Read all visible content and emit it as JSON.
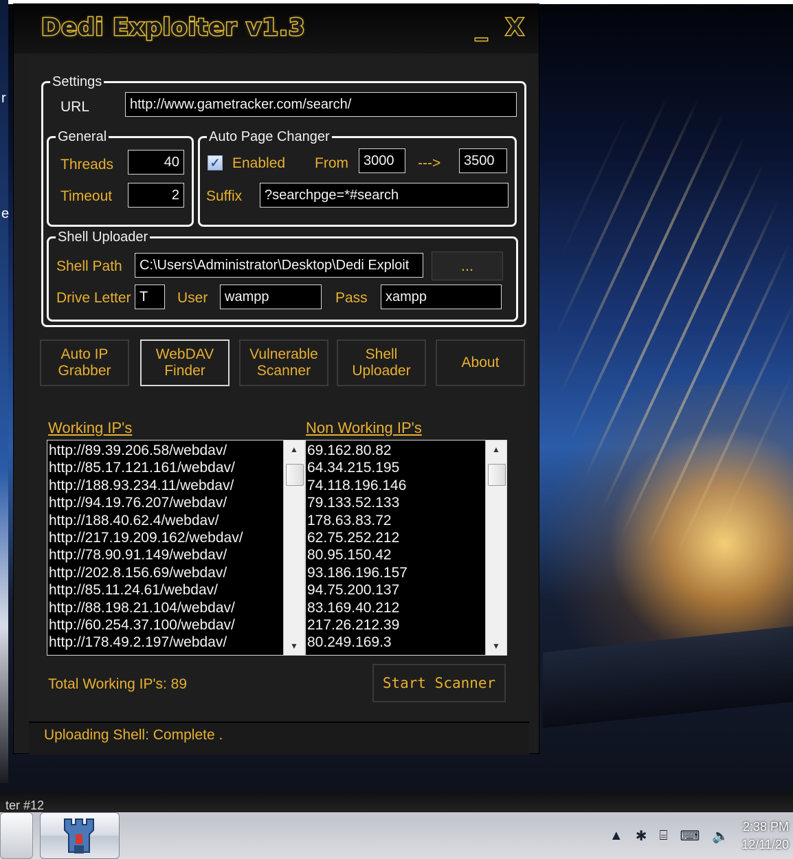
{
  "window": {
    "title": "Dedi Exploiter v1.3",
    "minimize": "_",
    "close": "X"
  },
  "settings": {
    "legend": "Settings",
    "url_label": "URL",
    "url_value": "http://www.gametracker.com/search/"
  },
  "general": {
    "legend": "General",
    "threads_label": "Threads",
    "threads_value": "40",
    "timeout_label": "Timeout",
    "timeout_value": "2"
  },
  "auto_page": {
    "legend": "Auto Page Changer",
    "enabled_label": "Enabled",
    "enabled_checked": true,
    "from_label": "From",
    "from_value": "3000",
    "arrow": "--->",
    "to_value": "3500",
    "suffix_label": "Suffix",
    "suffix_value": "?searchpge=*#search"
  },
  "shell": {
    "legend": "Shell Uploader",
    "path_label": "Shell Path",
    "path_value": "C:\\Users\\Administrator\\Desktop\\Dedi Exploit",
    "browse_label": "...",
    "drive_label": "Drive Letter",
    "drive_value": "T",
    "user_label": "User",
    "user_value": "wampp",
    "pass_label": "Pass",
    "pass_value": "xampp"
  },
  "tabs": [
    {
      "line1": "Auto IP",
      "line2": "Grabber"
    },
    {
      "line1": "WebDAV",
      "line2": "Finder"
    },
    {
      "line1": "Vulnerable",
      "line2": "Scanner"
    },
    {
      "line1": "Shell",
      "line2": "Uploader"
    },
    {
      "line1": "About",
      "line2": ""
    }
  ],
  "working": {
    "title": "Working IP's",
    "items": [
      "http://89.39.206.58/webdav/",
      "http://85.17.121.161/webdav/",
      "http://188.93.234.11/webdav/",
      "http://94.19.76.207/webdav/",
      "http://188.40.62.4/webdav/",
      "http://217.19.209.162/webdav/",
      "http://78.90.91.149/webdav/",
      "http://202.8.156.69/webdav/",
      "http://85.11.24.61/webdav/",
      "http://88.198.21.104/webdav/",
      "http://60.254.37.100/webdav/",
      "http://178.49.2.197/webdav/"
    ]
  },
  "nonworking": {
    "title": "Non Working IP's",
    "items": [
      "69.162.80.82",
      "64.34.215.195",
      "74.118.196.146",
      "79.133.52.133",
      "178.63.83.72",
      "62.75.252.212",
      "80.95.150.42",
      "93.186.196.157",
      "94.75.200.137",
      "83.169.40.212",
      "217.26.212.39",
      "80.249.169.3"
    ]
  },
  "total_label": "Total Working IP's: 89",
  "start_label": "Start  Scanner",
  "status": "Uploading Shell: Complete .",
  "taskbar": {
    "label": "ter #12",
    "time": "2:38 PM",
    "date": "12/11/20"
  },
  "desktop_edge": {
    "char1": "r",
    "char2": "e"
  },
  "colors": {
    "accent": "#e8b030",
    "window_bg": "#1e1e1e",
    "field_bg": "#000000"
  }
}
